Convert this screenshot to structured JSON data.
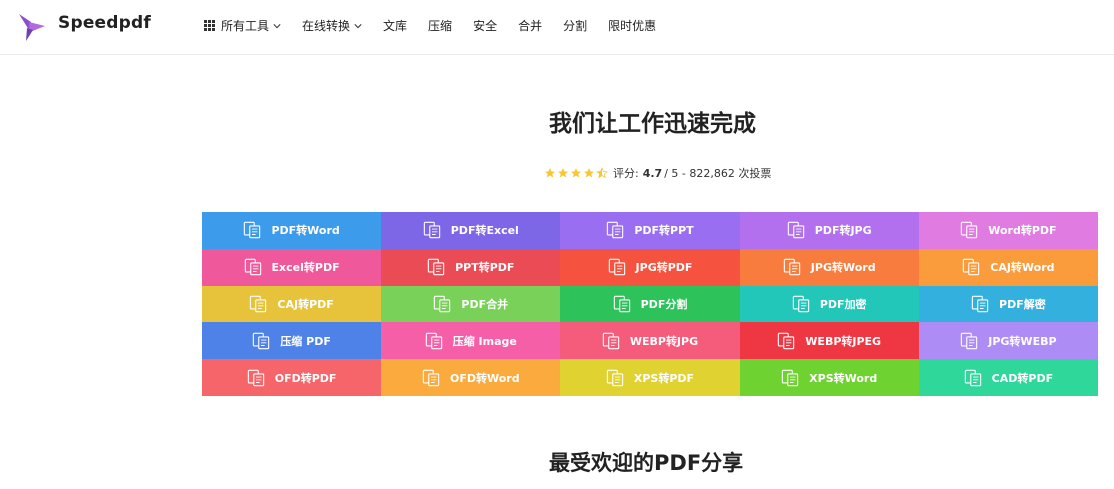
{
  "header": {
    "brand": "Speedpdf",
    "nav": [
      {
        "label": "所有工具",
        "icon": "grid-icon",
        "dropdown": true
      },
      {
        "label": "在线转换",
        "dropdown": true
      },
      {
        "label": "文库"
      },
      {
        "label": "压缩"
      },
      {
        "label": "安全"
      },
      {
        "label": "合并"
      },
      {
        "label": "分割"
      },
      {
        "label": "限时优惠"
      }
    ]
  },
  "hero": {
    "title": "我们让工作迅速完成",
    "rating_label": "评分:",
    "rating_value": "4.7",
    "rating_rest": "/ 5 - 822,862 次投票",
    "stars": 4.5
  },
  "tools": [
    {
      "label": "PDF转Word",
      "color": "#3d9bec",
      "icon": "pdf-to-doc-icon"
    },
    {
      "label": "PDF转Excel",
      "color": "#7d67e6",
      "icon": "pdf-to-xls-icon"
    },
    {
      "label": "PDF转PPT",
      "color": "#9a6ef0",
      "icon": "pdf-to-ppt-icon"
    },
    {
      "label": "PDF转JPG",
      "color": "#b270ee",
      "icon": "pdf-to-image-icon"
    },
    {
      "label": "Word转PDF",
      "color": "#e07be1",
      "icon": "doc-to-pdf-icon"
    },
    {
      "label": "Excel转PDF",
      "color": "#f0589c",
      "icon": "xls-to-pdf-icon"
    },
    {
      "label": "PPT转PDF",
      "color": "#ea4b55",
      "icon": "ppt-to-pdf-icon"
    },
    {
      "label": "JPG转PDF",
      "color": "#f5533f",
      "icon": "image-to-pdf-icon"
    },
    {
      "label": "JPG转Word",
      "color": "#f77c3e",
      "icon": "image-to-doc-icon"
    },
    {
      "label": "CAJ转Word",
      "color": "#fa9b3c",
      "icon": "caj-to-doc-icon"
    },
    {
      "label": "CAJ转PDF",
      "color": "#e6c33a",
      "icon": "caj-to-pdf-icon"
    },
    {
      "label": "PDF合并",
      "color": "#79d15a",
      "icon": "merge-icon"
    },
    {
      "label": "PDF分割",
      "color": "#2ec35a",
      "icon": "split-icon"
    },
    {
      "label": "PDF加密",
      "color": "#22c7b9",
      "icon": "lock-icon"
    },
    {
      "label": "PDF解密",
      "color": "#33b0de",
      "icon": "unlock-icon"
    },
    {
      "label": "压缩 PDF",
      "color": "#4f82e8",
      "icon": "compress-pdf-icon"
    },
    {
      "label": "压缩 Image",
      "color": "#f55fa7",
      "icon": "compress-image-icon"
    },
    {
      "label": "WEBP转JPG",
      "color": "#f55b7a",
      "icon": "webp-to-jpg-icon"
    },
    {
      "label": "WEBP转JPEG",
      "color": "#ee3743",
      "icon": "webp-to-jpeg-icon"
    },
    {
      "label": "JPG转WEBP",
      "color": "#ae8cf5",
      "icon": "jpg-to-webp-icon"
    },
    {
      "label": "OFD转PDF",
      "color": "#f5656a",
      "icon": "ofd-to-pdf-icon"
    },
    {
      "label": "OFD转Word",
      "color": "#fbaa3e",
      "icon": "ofd-to-doc-icon"
    },
    {
      "label": "XPS转PDF",
      "color": "#e0d230",
      "icon": "xps-to-pdf-icon"
    },
    {
      "label": "XPS转Word",
      "color": "#6ed231",
      "icon": "xps-to-doc-icon"
    },
    {
      "label": "CAD转PDF",
      "color": "#2fd79b",
      "icon": "cad-to-pdf-icon"
    }
  ],
  "section": {
    "title": "最受欢迎的PDF分享"
  }
}
